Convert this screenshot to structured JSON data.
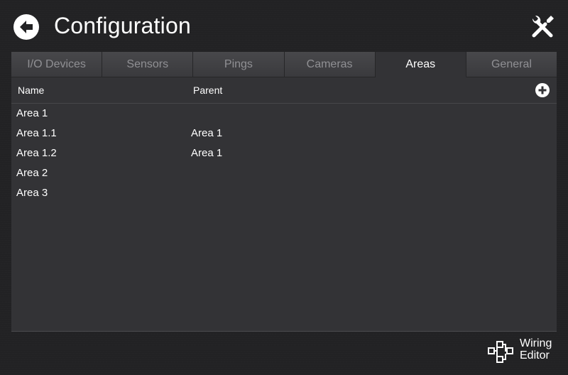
{
  "header": {
    "title": "Configuration",
    "back_icon": "back-arrow-icon",
    "tools_icon": "wrench-screwdriver-icon"
  },
  "tabs": [
    {
      "label": "I/O Devices",
      "active": false
    },
    {
      "label": "Sensors",
      "active": false
    },
    {
      "label": "Pings",
      "active": false
    },
    {
      "label": "Cameras",
      "active": false
    },
    {
      "label": "Areas",
      "active": true
    },
    {
      "label": "General",
      "active": false
    }
  ],
  "table": {
    "columns": {
      "name": "Name",
      "parent": "Parent"
    },
    "add_icon": "plus-circle-icon",
    "rows": [
      {
        "name": "Area 1",
        "parent": ""
      },
      {
        "name": "Area 1.1",
        "parent": "Area 1"
      },
      {
        "name": "Area 1.2",
        "parent": "Area 1"
      },
      {
        "name": "Area 2",
        "parent": ""
      },
      {
        "name": "Area 3",
        "parent": ""
      }
    ]
  },
  "footer": {
    "wiring_line1": "Wiring",
    "wiring_line2": "Editor",
    "wiring_icon": "wiring-diagram-icon"
  },
  "colors": {
    "background": "#222224",
    "panel": "#333336",
    "tab_inactive_text": "#909094",
    "text": "#ffffff"
  }
}
